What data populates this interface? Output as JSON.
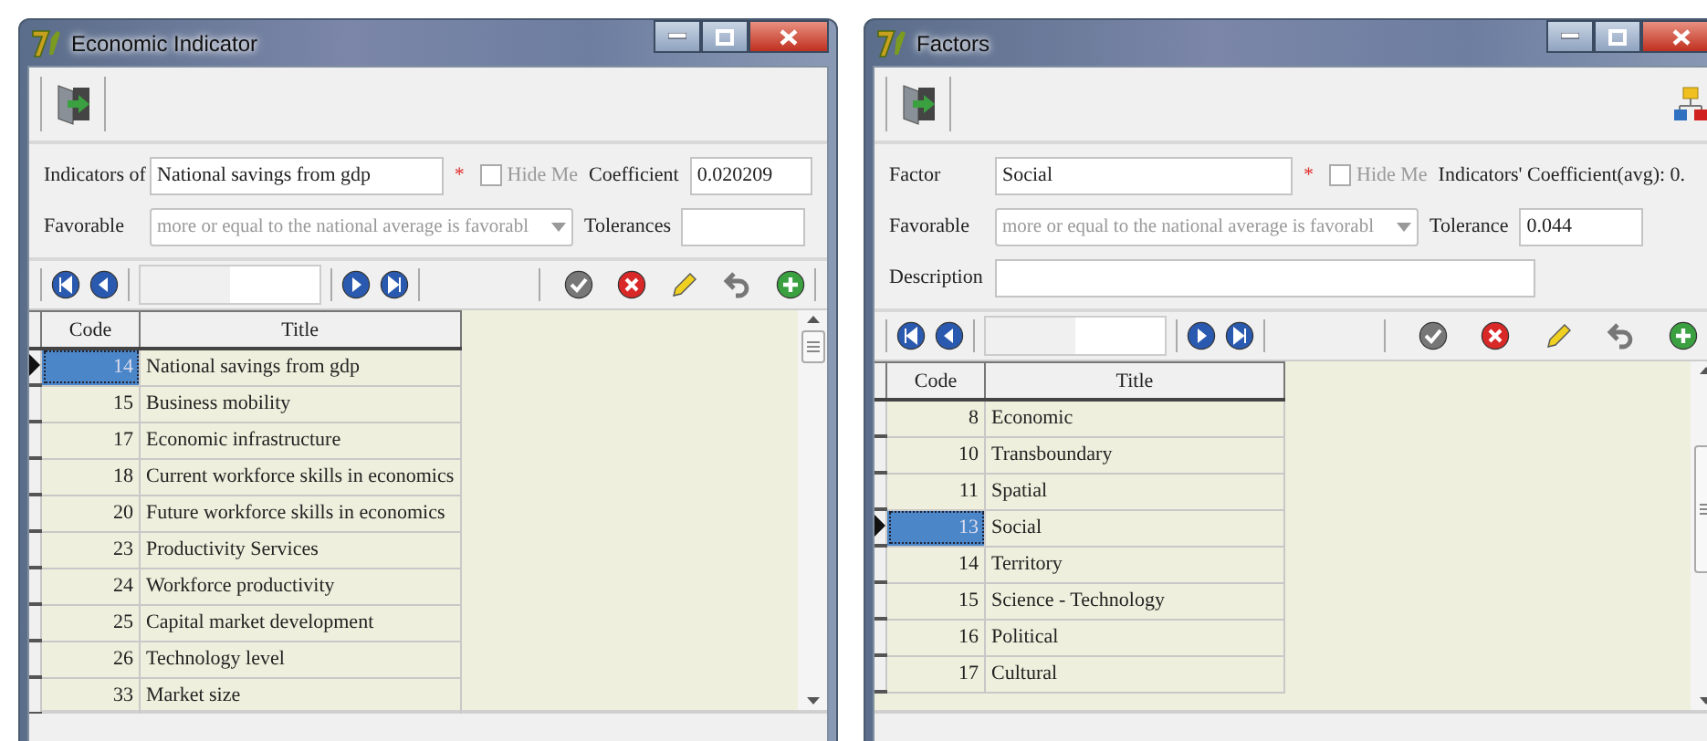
{
  "windows": [
    {
      "title": "Economic Indicator",
      "form": [
        [
          {
            "kind": "label",
            "text": "Indicators of"
          },
          {
            "kind": "main-field",
            "value": "National savings from gdp"
          },
          {
            "kind": "required",
            "text": "*"
          },
          {
            "kind": "checkbox",
            "text": "Hide Me",
            "checked": false
          },
          {
            "kind": "label",
            "text": "Coefficient"
          },
          {
            "kind": "short-field",
            "value": "0.020209"
          }
        ],
        [
          {
            "kind": "label",
            "text": "Favorable"
          },
          {
            "kind": "combo",
            "value": "more or equal to the national average is favorabl"
          },
          {
            "kind": "label",
            "text": "Tolerances"
          },
          {
            "kind": "short-field"
          }
        ]
      ],
      "grid": {
        "columns": [
          "Code",
          "Title"
        ],
        "rows": [
          {
            "code": "14",
            "title": "National savings from gdp",
            "selected": true
          },
          {
            "code": "15",
            "title": "Business mobility",
            "selected": false
          },
          {
            "code": "17",
            "title": "Economic infrastructure",
            "selected": false
          },
          {
            "code": "18",
            "title": "Current workforce skills in economics",
            "selected": false
          },
          {
            "code": "20",
            "title": "Future workforce skills in economics",
            "selected": false
          },
          {
            "code": "23",
            "title": "Productivity Services",
            "selected": false
          },
          {
            "code": "24",
            "title": "Workforce productivity",
            "selected": false
          },
          {
            "code": "25",
            "title": "Capital market development",
            "selected": false
          },
          {
            "code": "26",
            "title": "Technology level",
            "selected": false
          },
          {
            "code": "33",
            "title": "Market size",
            "selected": false
          }
        ]
      }
    },
    {
      "title": "Factors",
      "form": [
        [
          {
            "kind": "label",
            "text": "Factor"
          },
          {
            "kind": "main-field",
            "value": "Social"
          },
          {
            "kind": "required",
            "text": "*"
          },
          {
            "kind": "checkbox",
            "text": "Hide Me",
            "checked": false
          },
          {
            "kind": "label",
            "text": "Indicators' Coefficient(avg): 0."
          }
        ],
        [
          {
            "kind": "label",
            "text": "Favorable"
          },
          {
            "kind": "combo",
            "value": "more or equal to the national average is favorabl"
          },
          {
            "kind": "label",
            "text": "Tolerance"
          },
          {
            "kind": "short-field",
            "value": "0.044"
          }
        ],
        [
          {
            "kind": "label",
            "text": "Description"
          },
          {
            "kind": "long-field"
          }
        ]
      ],
      "grid": {
        "columns": [
          "Code",
          "Title"
        ],
        "rows": [
          {
            "code": "8",
            "title": "Economic",
            "selected": false
          },
          {
            "code": "10",
            "title": "Transboundary",
            "selected": false
          },
          {
            "code": "11",
            "title": "Spatial",
            "selected": false
          },
          {
            "code": "13",
            "title": "Social",
            "selected": true
          },
          {
            "code": "14",
            "title": "Territory",
            "selected": false
          },
          {
            "code": "15",
            "title": "Science - Technology",
            "selected": false
          },
          {
            "code": "16",
            "title": "Political",
            "selected": false
          },
          {
            "code": "17",
            "title": "Cultural",
            "selected": false
          }
        ]
      }
    }
  ]
}
